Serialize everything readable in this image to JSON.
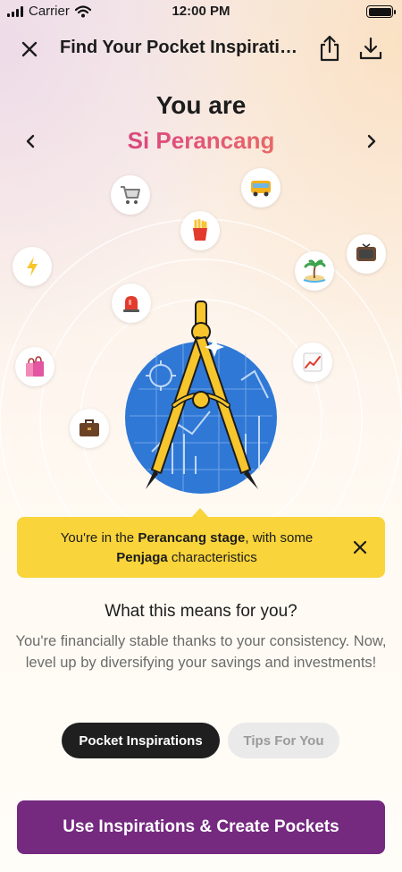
{
  "status_bar": {
    "carrier": "Carrier",
    "time": "12:00 PM"
  },
  "header": {
    "title": "Find Your Pocket Inspiratio...",
    "icons": [
      "close-icon",
      "share-icon",
      "download-icon"
    ]
  },
  "result": {
    "heading": "You are",
    "persona": "Si Perancang",
    "persona_gradient": [
      "#c43a86",
      "#f08a4e"
    ]
  },
  "illustration": {
    "center_icon": "compass-icon",
    "orbit_icons": [
      "shopping-cart-icon",
      "bus-icon",
      "fries-icon",
      "tv-icon",
      "lightning-icon",
      "island-icon",
      "siren-icon",
      "shopping-bags-icon",
      "chart-up-icon",
      "briefcase-icon"
    ]
  },
  "banner": {
    "prefix": "You're in the ",
    "stage": "Perancang stage",
    "middle": ", with some ",
    "trait": "Penjaga",
    "suffix": " characteristics",
    "color": "#f9d43a"
  },
  "meaning": {
    "title": "What this means for you?",
    "body": "You're financially stable thanks to your consistency. Now, level up by diversifying your savings and investments!"
  },
  "tabs": {
    "active": "Pocket Inspirations",
    "inactive": "Tips For You"
  },
  "cta": {
    "label": "Use Inspirations & Create Pockets",
    "color": "#752a80"
  }
}
